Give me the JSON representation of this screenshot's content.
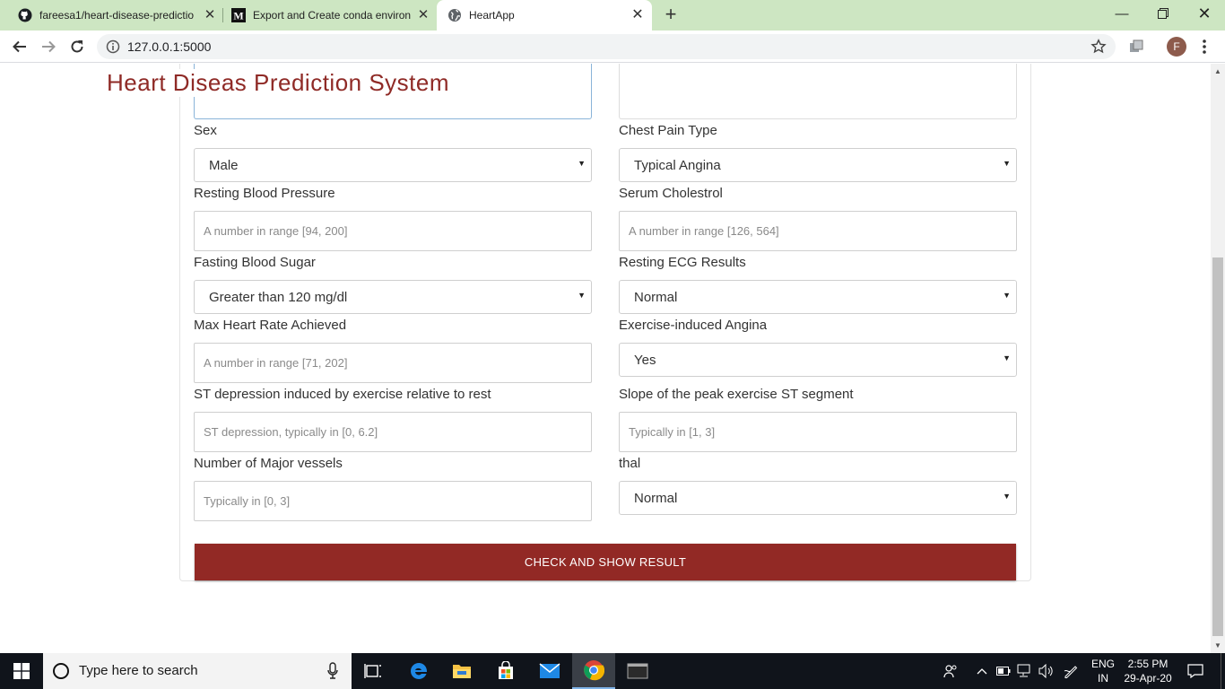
{
  "browser": {
    "tabs": [
      {
        "label": "fareesa1/heart-disease-predictio",
        "icon": "github-icon"
      },
      {
        "label": "Export and Create conda environ",
        "icon": "medium-icon"
      },
      {
        "label": "HeartApp",
        "icon": "globe-icon"
      }
    ],
    "url": "127.0.0.1:5000",
    "profile_initial": "F"
  },
  "page": {
    "title": "Heart Diseas Prediction System",
    "fields": {
      "sex": {
        "label": "Sex",
        "value": "Male"
      },
      "chest_pain": {
        "label": "Chest Pain Type",
        "value": "Typical Angina"
      },
      "resting_bp": {
        "label": "Resting Blood Pressure",
        "placeholder": "A number in range [94, 200]"
      },
      "cholestrol": {
        "label": "Serum Cholestrol",
        "placeholder": "A number in range [126, 564]"
      },
      "fbs": {
        "label": "Fasting Blood Sugar",
        "value": "Greater than 120 mg/dl"
      },
      "ecg": {
        "label": "Resting ECG Results",
        "value": "Normal"
      },
      "max_hr": {
        "label": "Max Heart Rate Achieved",
        "placeholder": "A number in range [71, 202]"
      },
      "exang": {
        "label": "Exercise-induced Angina",
        "value": "Yes"
      },
      "oldpeak": {
        "label": "ST depression induced by exercise relative to rest",
        "placeholder": "ST depression, typically in [0, 6.2]"
      },
      "slope": {
        "label": "Slope of the peak exercise ST segment",
        "placeholder": "Typically in [1, 3]"
      },
      "ca": {
        "label": "Number of Major vessels",
        "placeholder": "Typically in [0, 3]"
      },
      "thal": {
        "label": "thal",
        "value": "Normal"
      }
    },
    "submit_label": "CHECK AND SHOW RESULT",
    "accent_color": "#922925"
  },
  "taskbar": {
    "search_placeholder": "Type here to search",
    "lang_line1": "ENG",
    "lang_line2": "IN",
    "time": "2:55 PM",
    "date": "29-Apr-20"
  }
}
